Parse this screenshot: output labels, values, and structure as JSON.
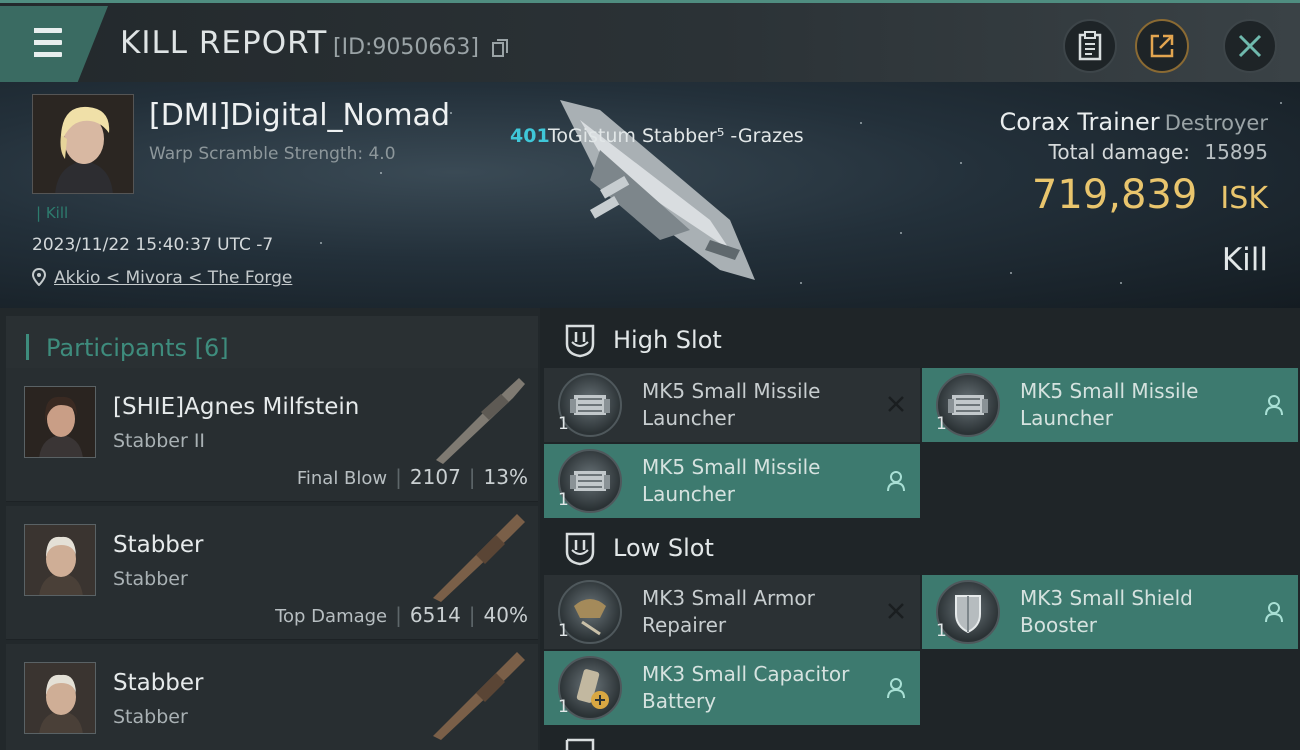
{
  "header": {
    "title": "KILL REPORT",
    "report_id": "[ID:9050663]",
    "icons": [
      "menu-icon",
      "copy-icon",
      "clipboard-icon",
      "share-icon",
      "close-icon"
    ]
  },
  "victim": {
    "name": "[DMI]Digital_Nomad",
    "warp_scramble": "Warp Scramble Strength: 4.0",
    "kill_tag": "| Kill",
    "datetime": "2023/11/22 15:40:37 UTC -7",
    "location": "Akkio < Mivora < The Forge",
    "target_number": "401",
    "target_name": "ToGistum Stabber⁵ -Grazes",
    "ship_name": "Corax Trainer",
    "ship_class": "Destroyer",
    "total_damage_label": "Total damage:",
    "total_damage": "15895",
    "isk_value": "719,839",
    "isk_unit": "ISK",
    "result": "Kill"
  },
  "participants": {
    "title": "Participants",
    "count": "[6]",
    "rows": [
      {
        "name": "[SHIE]Agnes Milfstein",
        "ship": "Stabber II",
        "tag": "Final Blow",
        "damage": "2107",
        "percent": "13%"
      },
      {
        "name": "Stabber",
        "ship": "Stabber",
        "tag": "Top Damage",
        "damage": "6514",
        "percent": "40%"
      },
      {
        "name": "Stabber",
        "ship": "Stabber",
        "tag": "",
        "damage": "",
        "percent": ""
      }
    ]
  },
  "slots": {
    "high": {
      "title": "High Slot",
      "items": [
        {
          "qty": "1",
          "name": "MK5 Small Missile Launcher",
          "status": "destroyed"
        },
        {
          "qty": "1",
          "name": "MK5 Small Missile Launcher",
          "status": "dropped"
        },
        {
          "qty": "1",
          "name": "MK5 Small Missile Launcher",
          "status": "dropped"
        }
      ]
    },
    "low": {
      "title": "Low Slot",
      "items": [
        {
          "qty": "1",
          "name": "MK3 Small Armor Repairer",
          "status": "destroyed"
        },
        {
          "qty": "1",
          "name": "MK3 Small Shield Booster",
          "status": "dropped"
        },
        {
          "qty": "1",
          "name": "MK3 Small Capacitor Battery",
          "status": "dropped"
        }
      ]
    }
  },
  "colors": {
    "accent": "#3e8c7d",
    "isk": "#e9c56d",
    "target_number": "#3fc7d8"
  }
}
